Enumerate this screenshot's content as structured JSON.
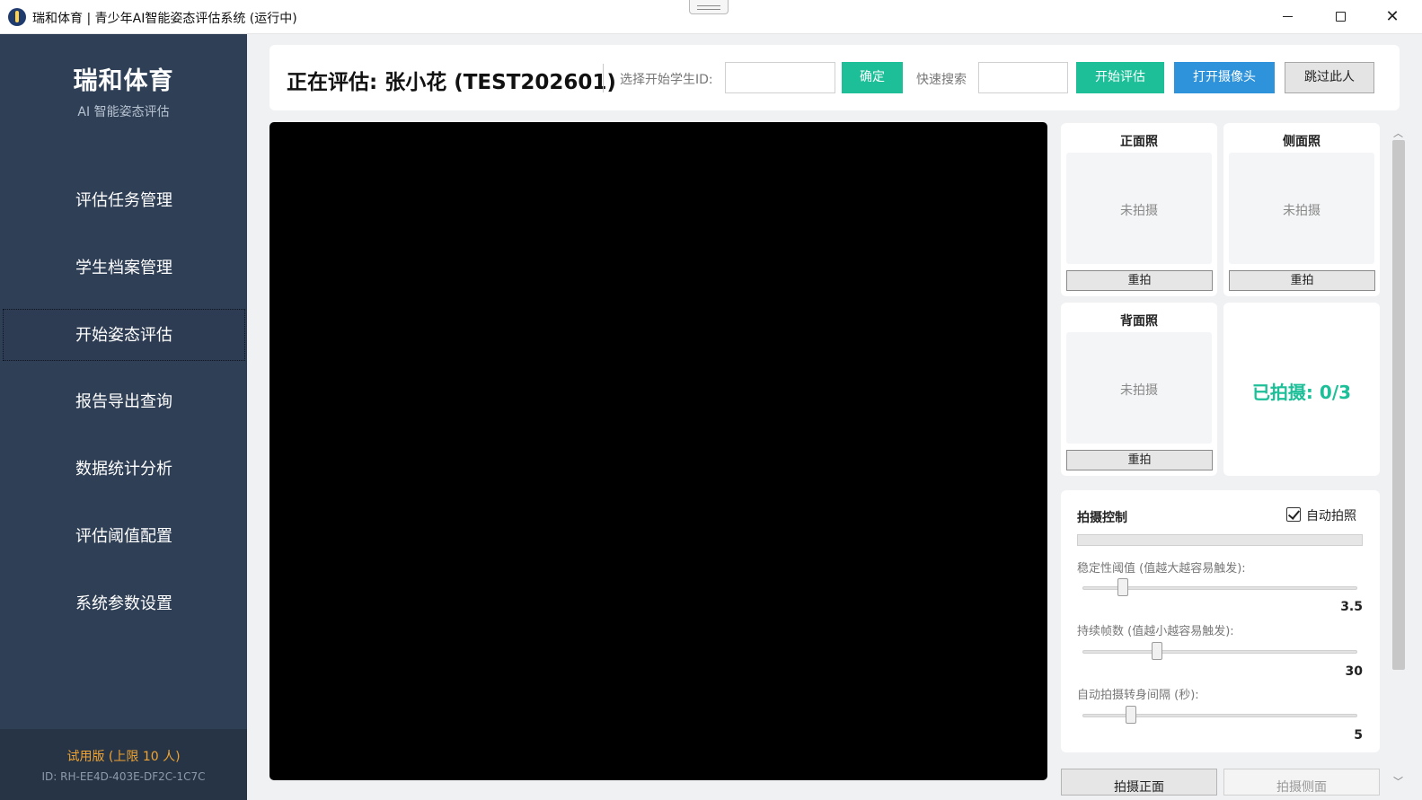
{
  "window": {
    "title": "瑞和体育 | 青少年AI智能姿态评估系统 (运行中)",
    "controls": [
      "minimize",
      "maximize",
      "close"
    ]
  },
  "sidebar": {
    "brand": "瑞和体育",
    "subtitle": "AI 智能姿态评估",
    "items": [
      {
        "label": "评估任务管理",
        "active": false
      },
      {
        "label": "学生档案管理",
        "active": false
      },
      {
        "label": "开始姿态评估",
        "active": true
      },
      {
        "label": "报告导出查询",
        "active": false
      },
      {
        "label": "数据统计分析",
        "active": false
      },
      {
        "label": "评估阈值配置",
        "active": false
      },
      {
        "label": "系统参数设置",
        "active": false
      }
    ],
    "license": "试用版 (上限 10 人)",
    "device_id": "ID: RH-EE4D-403E-DF2C-1C7C"
  },
  "topbar": {
    "eval_title": "正在评估: 张小花 (TEST202601)",
    "select_id_label": "选择开始学生ID:",
    "select_id_value": "",
    "confirm_label": "确定",
    "search_label": "快速搜索",
    "search_value": "",
    "start_label": "开始评估",
    "camera_label": "打开摄像头",
    "skip_label": "跳过此人"
  },
  "shots": {
    "front": {
      "title": "正面照",
      "status": "未拍摄",
      "retake": "重拍"
    },
    "side": {
      "title": "侧面照",
      "status": "未拍摄",
      "retake": "重拍"
    },
    "back": {
      "title": "背面照",
      "status": "未拍摄",
      "retake": "重拍"
    },
    "count": "已拍摄: 0/3"
  },
  "control": {
    "title": "拍摄控制",
    "auto_label": "自动拍照",
    "auto_checked": true,
    "progress": 0,
    "sliders": [
      {
        "label": "稳定性阈值 (值越大越容易触发):",
        "value": "3.5",
        "level": 0.13
      },
      {
        "label": "持续帧数 (值越小越容易触发):",
        "value": "30",
        "level": 0.26
      },
      {
        "label": "自动拍摄转身间隔 (秒):",
        "value": "5",
        "level": 0.16
      }
    ]
  },
  "bottom_buttons": {
    "capture_front": "拍摄正面",
    "capture_side": "拍摄侧面"
  },
  "colors": {
    "sidebar_bg": "#2f3f55",
    "accent_green": "#1dbf98",
    "accent_blue": "#2f93dc",
    "license_orange": "#f1a431"
  }
}
